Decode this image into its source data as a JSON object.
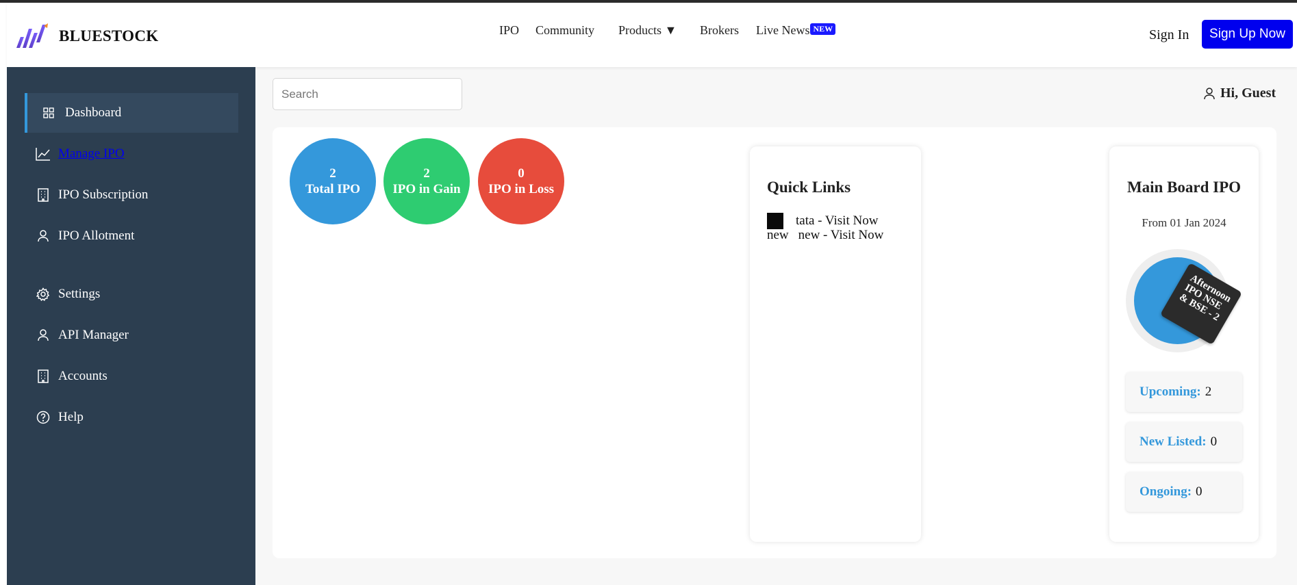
{
  "brand": {
    "name": "BLUESTOCK",
    "logo_icon": "bluestock-logo-icon"
  },
  "nav": {
    "items": [
      {
        "label": "IPO"
      },
      {
        "label": "Community"
      },
      {
        "label": "Products ▼"
      },
      {
        "label": "Brokers"
      },
      {
        "label": "Live News"
      }
    ],
    "new_badge": "NEW",
    "sign_in": "Sign In",
    "sign_up": "Sign Up Now"
  },
  "sidebar": {
    "items": [
      {
        "label": "Dashboard",
        "icon": "grid-icon",
        "active": true
      },
      {
        "label": "Manage IPO",
        "icon": "chart-line-icon",
        "link": true
      },
      {
        "label": "IPO Subscription",
        "icon": "building-icon"
      },
      {
        "label": "IPO Allotment",
        "icon": "user-icon"
      },
      {
        "label": "Settings",
        "icon": "gear-icon"
      },
      {
        "label": "API Manager",
        "icon": "user-icon"
      },
      {
        "label": "Accounts",
        "icon": "building-icon"
      },
      {
        "label": "Help",
        "icon": "help-icon"
      }
    ]
  },
  "search": {
    "placeholder": "Search",
    "value": ""
  },
  "greeting": "Hi, Guest",
  "stats": [
    {
      "value": "2",
      "label": "Total IPO",
      "color": "#3498db"
    },
    {
      "value": "2",
      "label": "IPO in Gain",
      "color": "#2ecc71"
    },
    {
      "value": "0",
      "label": "IPO in Loss",
      "color": "#e74c3c"
    }
  ],
  "quick_links": {
    "title": "Quick Links",
    "links": [
      {
        "alt": "",
        "text": "tata - Visit Now"
      },
      {
        "alt": "new",
        "text": "new - Visit Now"
      }
    ]
  },
  "main_board": {
    "title": "Main Board IPO",
    "subtitle": "From 01 Jan 2024",
    "tag_text": "Afternoon IPO NSE & BSE - 2",
    "stats": [
      {
        "label": "Upcoming:",
        "value": "2"
      },
      {
        "label": "New Listed:",
        "value": "0"
      },
      {
        "label": "Ongoing:",
        "value": "0"
      }
    ]
  },
  "colors": {
    "sidebar": "#2c3e50",
    "accent": "#3498db",
    "signup": "#0000ee"
  }
}
